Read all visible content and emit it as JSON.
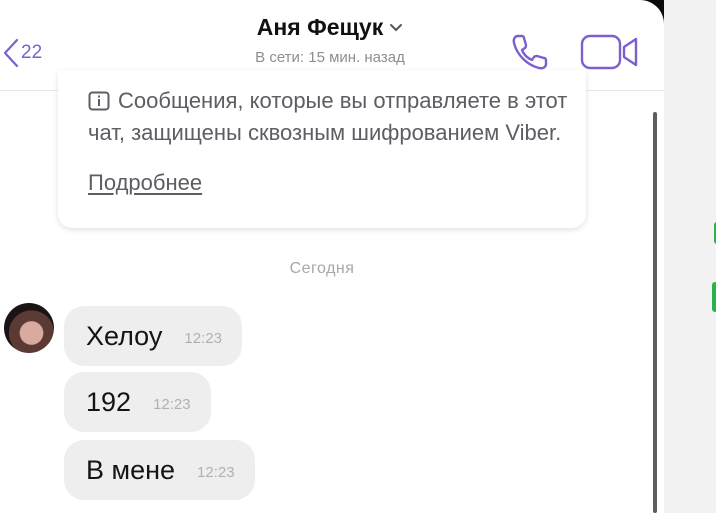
{
  "header": {
    "back_count": "22",
    "contact_name": "Аня Фещук",
    "status": "В сети: 15 мин. назад",
    "icons": {
      "back": "chevron-left-icon",
      "call": "phone-icon",
      "video": "video-camera-icon",
      "dropdown": "chevron-down-icon"
    }
  },
  "notice": {
    "text": "Сообщения, которые вы отправляете в этот чат, защищены сквозным шифрованием Viber.",
    "link": "Подробнее",
    "icon": "encryption-icon"
  },
  "date_separator": "Сегодня",
  "messages": [
    {
      "text": "Хелоу",
      "time": "12:23"
    },
    {
      "text": "192",
      "time": "12:23"
    },
    {
      "text": "В мене",
      "time": "12:23"
    }
  ],
  "colors": {
    "accent": "#7d5fce",
    "bubble": "#eeeeef",
    "background": "#ffffff"
  }
}
